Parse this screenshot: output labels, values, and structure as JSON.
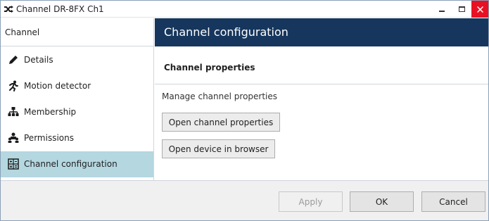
{
  "window": {
    "title": "Channel DR-8FX Ch1",
    "app_icon": "shuffle-icon",
    "controls": [
      "minimize-icon",
      "maximize-icon",
      "close-icon"
    ],
    "close_color": "#e81123"
  },
  "sidebar": {
    "header": "Channel",
    "items": [
      {
        "label": "Details",
        "icon": "pencil-icon",
        "selected": false
      },
      {
        "label": "Motion detector",
        "icon": "running-man-icon",
        "selected": false
      },
      {
        "label": "Membership",
        "icon": "org-chart-icon",
        "selected": false
      },
      {
        "label": "Permissions",
        "icon": "users-hierarchy-icon",
        "selected": false
      },
      {
        "label": "Channel configuration",
        "icon": "calculator-icon",
        "selected": true
      }
    ],
    "selected_color": "#b4d7e0"
  },
  "main": {
    "header": "Channel configuration",
    "header_color": "#16365d",
    "section_title": "Channel properties",
    "manage_text": "Manage channel properties",
    "open_properties_label": "Open channel properties",
    "open_browser_label": "Open device in browser"
  },
  "footer": {
    "apply_label": "Apply",
    "apply_disabled": true,
    "ok_label": "OK",
    "cancel_label": "Cancel"
  }
}
